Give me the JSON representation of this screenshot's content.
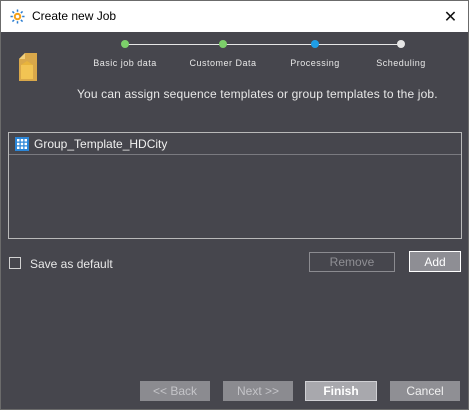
{
  "window": {
    "title": "Create new Job",
    "close_glyph": "✕"
  },
  "wizard": {
    "steps": [
      {
        "label": "Basic job data",
        "state": "done",
        "color": "#7ccf6a"
      },
      {
        "label": "Customer Data",
        "state": "done",
        "color": "#7ccf6a"
      },
      {
        "label": "Processing",
        "state": "current",
        "color": "#1f9ee6"
      },
      {
        "label": "Scheduling",
        "state": "pending",
        "color": "#e6e6e6"
      }
    ],
    "hint": "You can assign sequence templates or group templates to the job."
  },
  "template_list": {
    "items": [
      {
        "label": "Group_Template_HDCity",
        "icon": "group-template-icon"
      }
    ]
  },
  "options": {
    "save_default_label": "Save as default",
    "save_default_checked": false
  },
  "actions": {
    "remove_label": "Remove",
    "add_label": "Add"
  },
  "footer": {
    "back_label": "<< Back",
    "next_label": "Next >>",
    "finish_label": "Finish",
    "cancel_label": "Cancel"
  }
}
